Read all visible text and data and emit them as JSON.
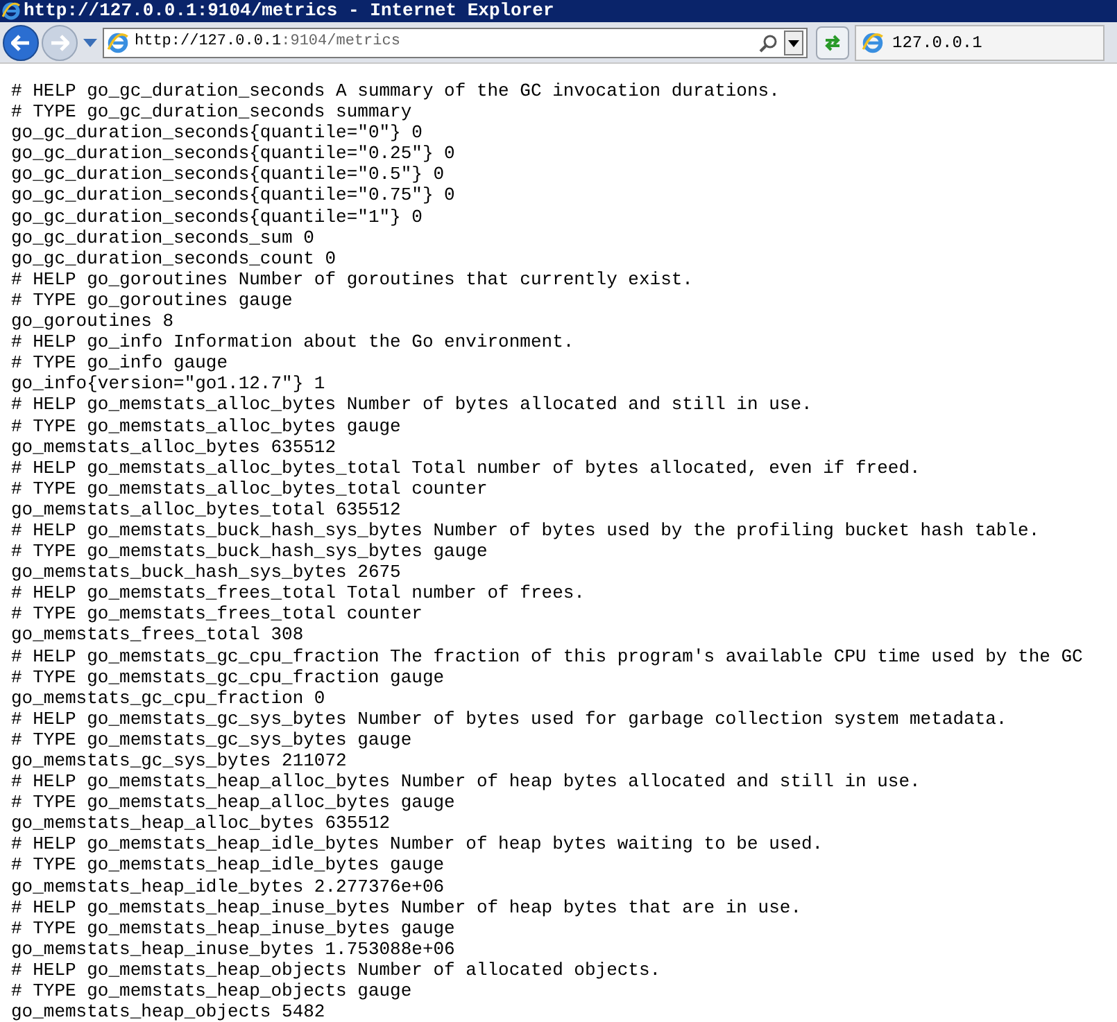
{
  "window": {
    "title": "http://127.0.0.1:9104/metrics - Internet Explorer"
  },
  "address_bar": {
    "host": "http://127.0.0.1",
    "rest": ":9104/metrics"
  },
  "tabs": [
    {
      "label": "127.0.0.1",
      "selected": true
    }
  ],
  "lines": [
    "# HELP go_gc_duration_seconds A summary of the GC invocation durations.",
    "# TYPE go_gc_duration_seconds summary",
    "go_gc_duration_seconds{quantile=\"0\"} 0",
    "go_gc_duration_seconds{quantile=\"0.25\"} 0",
    "go_gc_duration_seconds{quantile=\"0.5\"} 0",
    "go_gc_duration_seconds{quantile=\"0.75\"} 0",
    "go_gc_duration_seconds{quantile=\"1\"} 0",
    "go_gc_duration_seconds_sum 0",
    "go_gc_duration_seconds_count 0",
    "# HELP go_goroutines Number of goroutines that currently exist.",
    "# TYPE go_goroutines gauge",
    "go_goroutines 8",
    "# HELP go_info Information about the Go environment.",
    "# TYPE go_info gauge",
    "go_info{version=\"go1.12.7\"} 1",
    "# HELP go_memstats_alloc_bytes Number of bytes allocated and still in use.",
    "# TYPE go_memstats_alloc_bytes gauge",
    "go_memstats_alloc_bytes 635512",
    "# HELP go_memstats_alloc_bytes_total Total number of bytes allocated, even if freed.",
    "# TYPE go_memstats_alloc_bytes_total counter",
    "go_memstats_alloc_bytes_total 635512",
    "# HELP go_memstats_buck_hash_sys_bytes Number of bytes used by the profiling bucket hash table.",
    "# TYPE go_memstats_buck_hash_sys_bytes gauge",
    "go_memstats_buck_hash_sys_bytes 2675",
    "# HELP go_memstats_frees_total Total number of frees.",
    "# TYPE go_memstats_frees_total counter",
    "go_memstats_frees_total 308",
    "# HELP go_memstats_gc_cpu_fraction The fraction of this program's available CPU time used by the GC",
    "# TYPE go_memstats_gc_cpu_fraction gauge",
    "go_memstats_gc_cpu_fraction 0",
    "# HELP go_memstats_gc_sys_bytes Number of bytes used for garbage collection system metadata.",
    "# TYPE go_memstats_gc_sys_bytes gauge",
    "go_memstats_gc_sys_bytes 211072",
    "# HELP go_memstats_heap_alloc_bytes Number of heap bytes allocated and still in use.",
    "# TYPE go_memstats_heap_alloc_bytes gauge",
    "go_memstats_heap_alloc_bytes 635512",
    "# HELP go_memstats_heap_idle_bytes Number of heap bytes waiting to be used.",
    "# TYPE go_memstats_heap_idle_bytes gauge",
    "go_memstats_heap_idle_bytes 2.277376e+06",
    "# HELP go_memstats_heap_inuse_bytes Number of heap bytes that are in use.",
    "# TYPE go_memstats_heap_inuse_bytes gauge",
    "go_memstats_heap_inuse_bytes 1.753088e+06",
    "# HELP go_memstats_heap_objects Number of allocated objects.",
    "# TYPE go_memstats_heap_objects gauge",
    "go_memstats_heap_objects 5482"
  ]
}
